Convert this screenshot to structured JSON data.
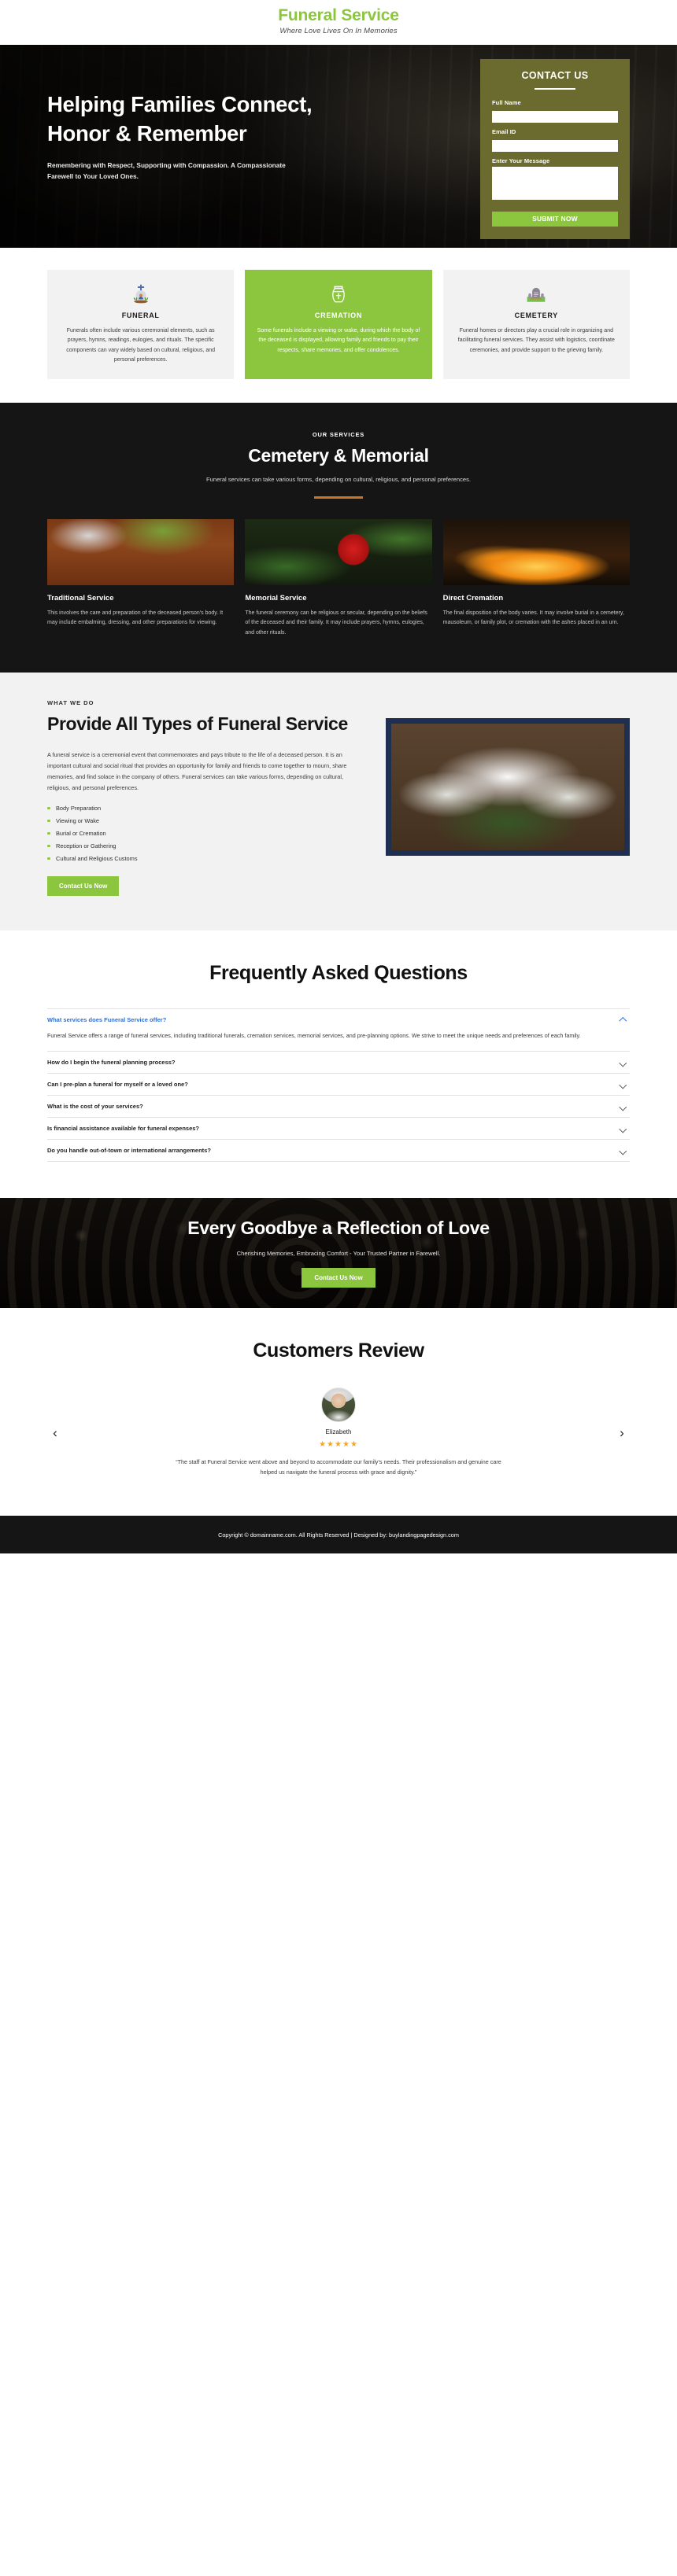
{
  "header": {
    "logo_title": "Funeral Service",
    "logo_tagline": "Where Love Lives On In Memories"
  },
  "hero": {
    "title": "Helping Families Connect, Honor & Remember",
    "subtitle": "Remembering with Respect, Supporting with Compassion. A Compassionate Farewell to Your Loved Ones.",
    "form": {
      "title": "CONTACT US",
      "name_label": "Full Name",
      "name_value": "",
      "email_label": "Email ID",
      "email_value": "",
      "message_label": "Enter Your Message",
      "message_value": "",
      "submit_label": "SUBMIT NOW"
    }
  },
  "features": [
    {
      "icon": "grave-icon",
      "title": "FUNERAL",
      "text": "Funerals often include various ceremonial elements, such as prayers, hymns, readings, eulogies, and rituals. The specific components can vary widely based on cultural, religious, and personal preferences."
    },
    {
      "icon": "urn-icon",
      "title": "CREMATION",
      "text": "Some funerals include a viewing or wake, during which the body of the deceased is displayed, allowing family and friends to pay their respects, share memories, and offer condolences."
    },
    {
      "icon": "tombstone-icon",
      "title": "CEMETERY",
      "text": "Funeral homes or directors play a crucial role in organizing and facilitating funeral services. They assist with logistics, coordinate ceremonies, and provide support to the grieving family."
    }
  ],
  "services": {
    "eyebrow": "OUR SERVICES",
    "title": "Cemetery & Memorial",
    "subtitle": "Funeral services can take various forms, depending on cultural, religious, and personal preferences.",
    "accent_color": "#c8772a",
    "items": [
      {
        "image": "casket-flowers-photo",
        "title": "Traditional Service",
        "text": "This involves the care and preparation of the deceased person's body. It may include embalming, dressing, and other preparations for viewing."
      },
      {
        "image": "red-rose-photo",
        "title": "Memorial Service",
        "text": "The funeral ceremony can be religious or secular, depending on the beliefs of the deceased and their family. It may include prayers, hymns, eulogies, and other rituals."
      },
      {
        "image": "cremation-fire-photo",
        "title": "Direct Cremation",
        "text": "The final disposition of the body varies. It may involve burial in a cemetery, mausoleum, or family plot, or cremation with the ashes placed in an urn."
      }
    ]
  },
  "whatwedo": {
    "eyebrow": "WHAT WE DO",
    "title": "Provide All Types of Funeral Service",
    "body": "A funeral service is a ceremonial event that commemorates and pays tribute to the life of a deceased person. It is an important cultural and social ritual that provides an opportunity for family and friends to come together to mourn, share memories, and find solace in the company of others. Funeral services can take various forms, depending on cultural, religious, and personal preferences.",
    "bullets": [
      "Body Preparation",
      "Viewing or Wake",
      "Burial or Cremation",
      "Reception or Gathering",
      "Cultural and Religious Customs"
    ],
    "cta_label": "Contact Us Now",
    "image": "white-lily-bouquet-photo"
  },
  "faq": {
    "title": "Frequently Asked Questions",
    "items": [
      {
        "question": "What services does Funeral Service offer?",
        "answer": "Funeral Service offers a range of funeral services, including traditional funerals, cremation services, memorial services, and pre-planning options. We strive to meet the unique needs and preferences of each family.",
        "open": true
      },
      {
        "question": "How do I begin the funeral planning process?",
        "answer": "",
        "open": false
      },
      {
        "question": "Can I pre-plan a funeral for myself or a loved one?",
        "answer": "",
        "open": false
      },
      {
        "question": "What is the cost of your services?",
        "answer": "",
        "open": false
      },
      {
        "question": "Is financial assistance available for funeral expenses?",
        "answer": "",
        "open": false
      },
      {
        "question": "Do you handle out-of-town or international arrangements?",
        "answer": "",
        "open": false
      }
    ]
  },
  "cta": {
    "title": "Every Goodbye a Reflection of Love",
    "subtitle": "Cherishing Memories, Embracing Comfort - Your Trusted Partner in Farewell.",
    "button_label": "Contact Us Now"
  },
  "reviews": {
    "title": "Customers Review",
    "prev_icon": "chevron-left-icon",
    "next_icon": "chevron-right-icon",
    "current": {
      "avatar": "elderly-woman-avatar",
      "name": "Elizabeth",
      "stars": "★★★★★",
      "rating": 5,
      "text": "“The staff at Funeral Service went above and beyond to accommodate our family’s needs. Their professionalism and genuine care helped us navigate the funeral process with grace and dignity.”"
    }
  },
  "footer": {
    "text": "Copyright © domainname.com. All Rights Reserved | Designed by: buylandingpagedesign.com"
  },
  "colors": {
    "brand_green": "#8cc63e",
    "olive": "#6b6b30",
    "dark": "#151515",
    "accent_orange": "#c8772a",
    "link_blue": "#2f6fd0",
    "star_gold": "#f5a623"
  }
}
